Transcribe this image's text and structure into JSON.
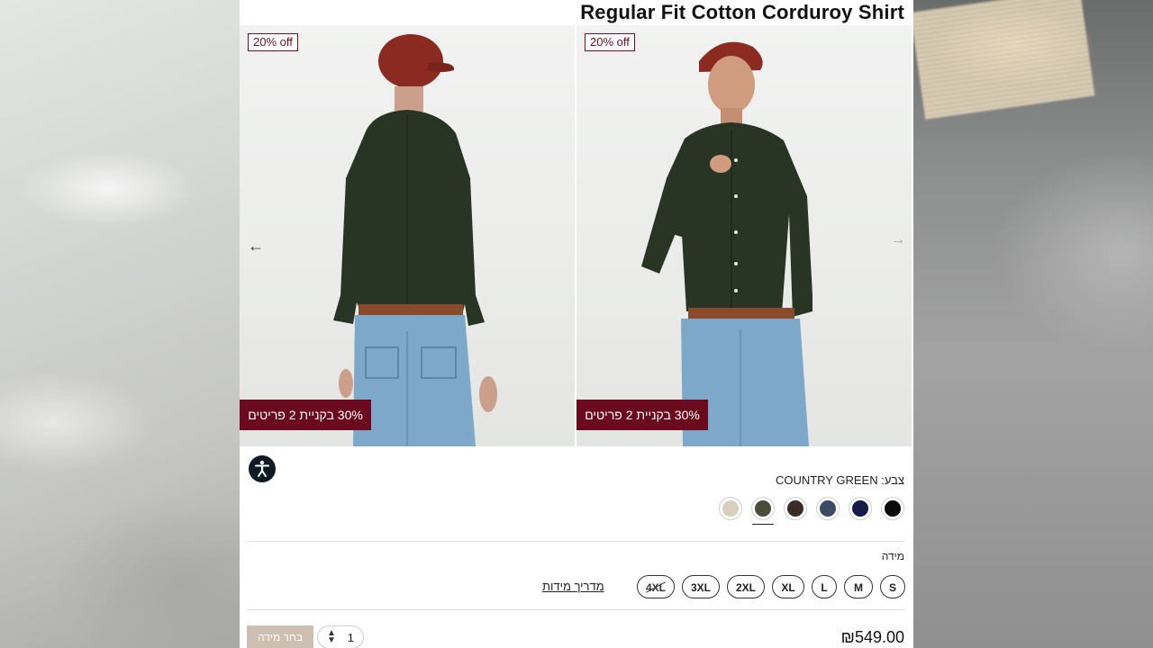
{
  "product": {
    "title": "Regular Fit Cotton Corduroy Shirt",
    "price": "₪549.00"
  },
  "gallery": {
    "images": [
      {
        "name": "back-view",
        "discount_badge": "20% off",
        "promo_banner": "30% בקניית 2 פריטים"
      },
      {
        "name": "front-view",
        "discount_badge": "20% off",
        "promo_banner": "30% בקניית 2 פריטים"
      }
    ],
    "prev_arrow": "←",
    "next_arrow": "→"
  },
  "color": {
    "label": "צבע:",
    "selected": "COUNTRY GREEN",
    "swatches": [
      {
        "name": "beige",
        "hex": "#d8cfbd"
      },
      {
        "name": "country-green",
        "hex": "#4a4d3a",
        "selected": true
      },
      {
        "name": "dark-brown",
        "hex": "#3b2c28"
      },
      {
        "name": "slate-blue",
        "hex": "#3c4a66"
      },
      {
        "name": "navy",
        "hex": "#141a4a"
      },
      {
        "name": "black",
        "hex": "#0b0b0b"
      }
    ]
  },
  "size": {
    "label": "מידה",
    "options": [
      "S",
      "M",
      "L",
      "XL",
      "2XL",
      "3XL",
      "4XL"
    ],
    "unavailable": [
      "4XL"
    ],
    "guide_label": "מדריך מידות"
  },
  "purchase": {
    "quantity": "1",
    "add_button": "בחר מידה"
  },
  "colors": {
    "promo_bg": "#6b0a1f",
    "badge": "#7a0a1e",
    "shirt": "#283524",
    "cap": "#8a2a20",
    "jeans": "#7ea8c9"
  }
}
